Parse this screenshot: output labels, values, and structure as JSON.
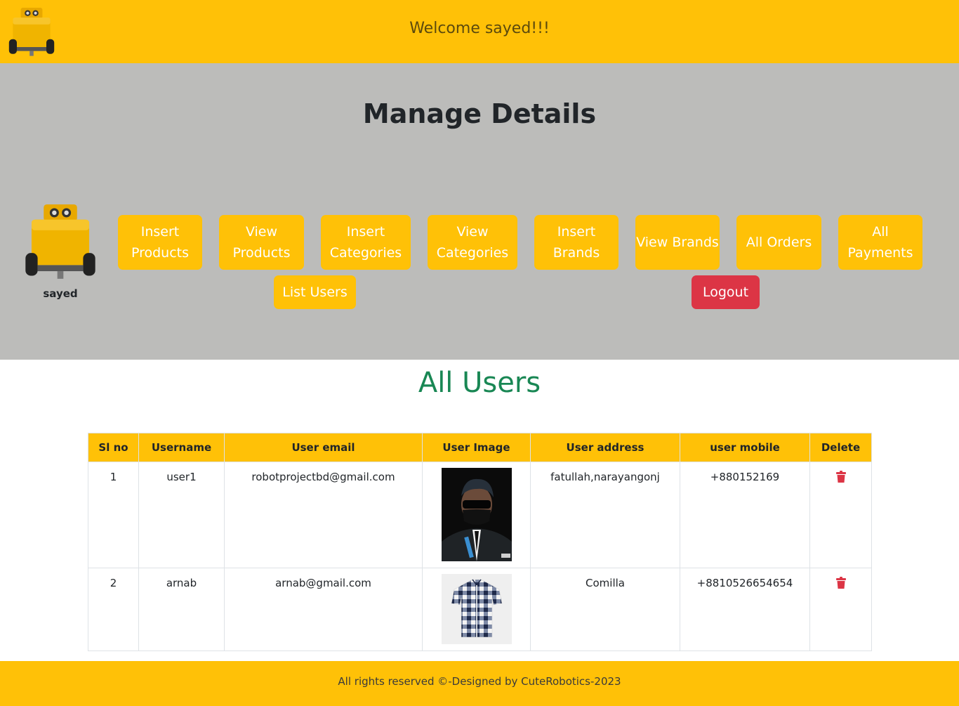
{
  "header": {
    "welcome": "Welcome sayed!!!",
    "logo_icon": "robot-icon"
  },
  "manage": {
    "title": "Manage Details",
    "profile": {
      "name": "sayed",
      "avatar_icon": "robot-icon"
    },
    "nav": [
      {
        "label": "Insert Products"
      },
      {
        "label": "View Products"
      },
      {
        "label": "Insert Categories"
      },
      {
        "label": "View Categories"
      },
      {
        "label": "Insert Brands"
      },
      {
        "label": "View Brands"
      },
      {
        "label": "All Orders"
      },
      {
        "label": "All Payments"
      },
      {
        "label": "List Users"
      },
      {
        "label": "Logout"
      }
    ]
  },
  "users": {
    "title": "All Users",
    "columns": [
      "Sl no",
      "Username",
      "User email",
      "User Image",
      "User address",
      "user mobile",
      "Delete"
    ],
    "rows": [
      {
        "sl": "1",
        "username": "user1",
        "email": "robotprojectbd@gmail.com",
        "image": "person-photo",
        "address": "fatullah,narayangonj",
        "mobile": "+880152169"
      },
      {
        "sl": "2",
        "username": "arnab",
        "email": "arnab@gmail.com",
        "image": "checked-shirt-photo",
        "address": "Comilla",
        "mobile": "+8810526654654"
      }
    ]
  },
  "footer": {
    "text": "All rights reserved ©-Designed by CuteRobotics-2023"
  },
  "colors": {
    "accent": "#ffc107",
    "danger": "#dc3545",
    "success": "#198754",
    "panel": "#bcbcba"
  }
}
